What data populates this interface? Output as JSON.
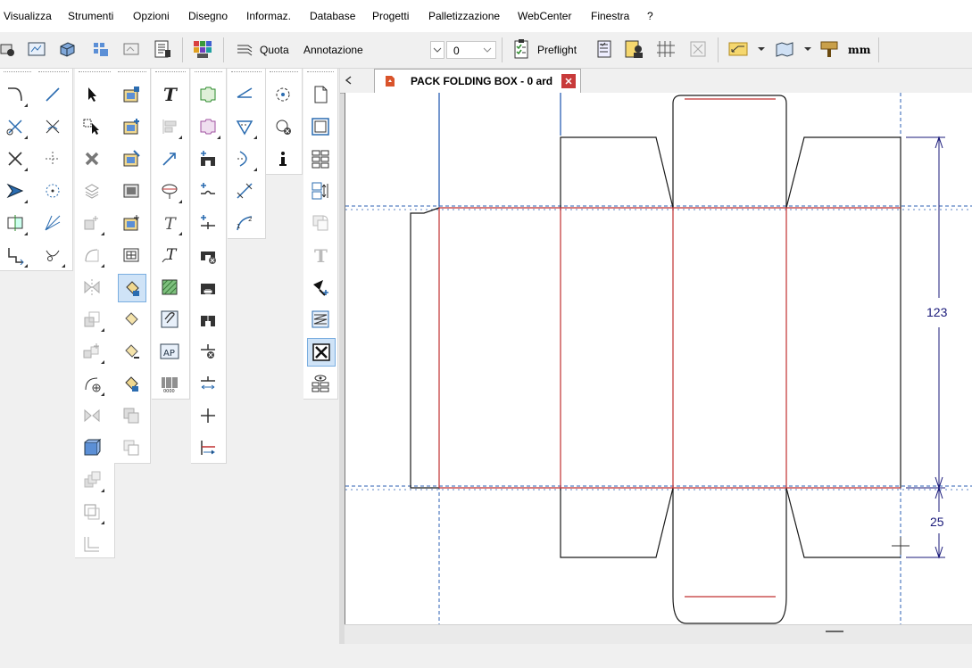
{
  "menu": [
    "Visualizza",
    "Strumenti",
    "Opzioni",
    "Disegno",
    "Informaz.",
    "Database",
    "Progetti",
    "Palletizzazione",
    "WebCenter",
    "Finestra",
    "?"
  ],
  "toolbar": {
    "quota_label": "Quota",
    "annotation_label": "Annotazione",
    "layer_value": "0",
    "preflight_label": "Preflight",
    "units_label": "mm"
  },
  "document": {
    "tab_title": "PACK FOLDING BOX - 0 ard"
  },
  "dimensions": {
    "height_value": "123",
    "flap_value": "25"
  },
  "colors": {
    "cut_line": "#1a1a1a",
    "crease_line": "#c03030",
    "guide_line": "#2b5fb3",
    "dimension": "#1a1a7a",
    "tab_icon": "#d9542b"
  }
}
